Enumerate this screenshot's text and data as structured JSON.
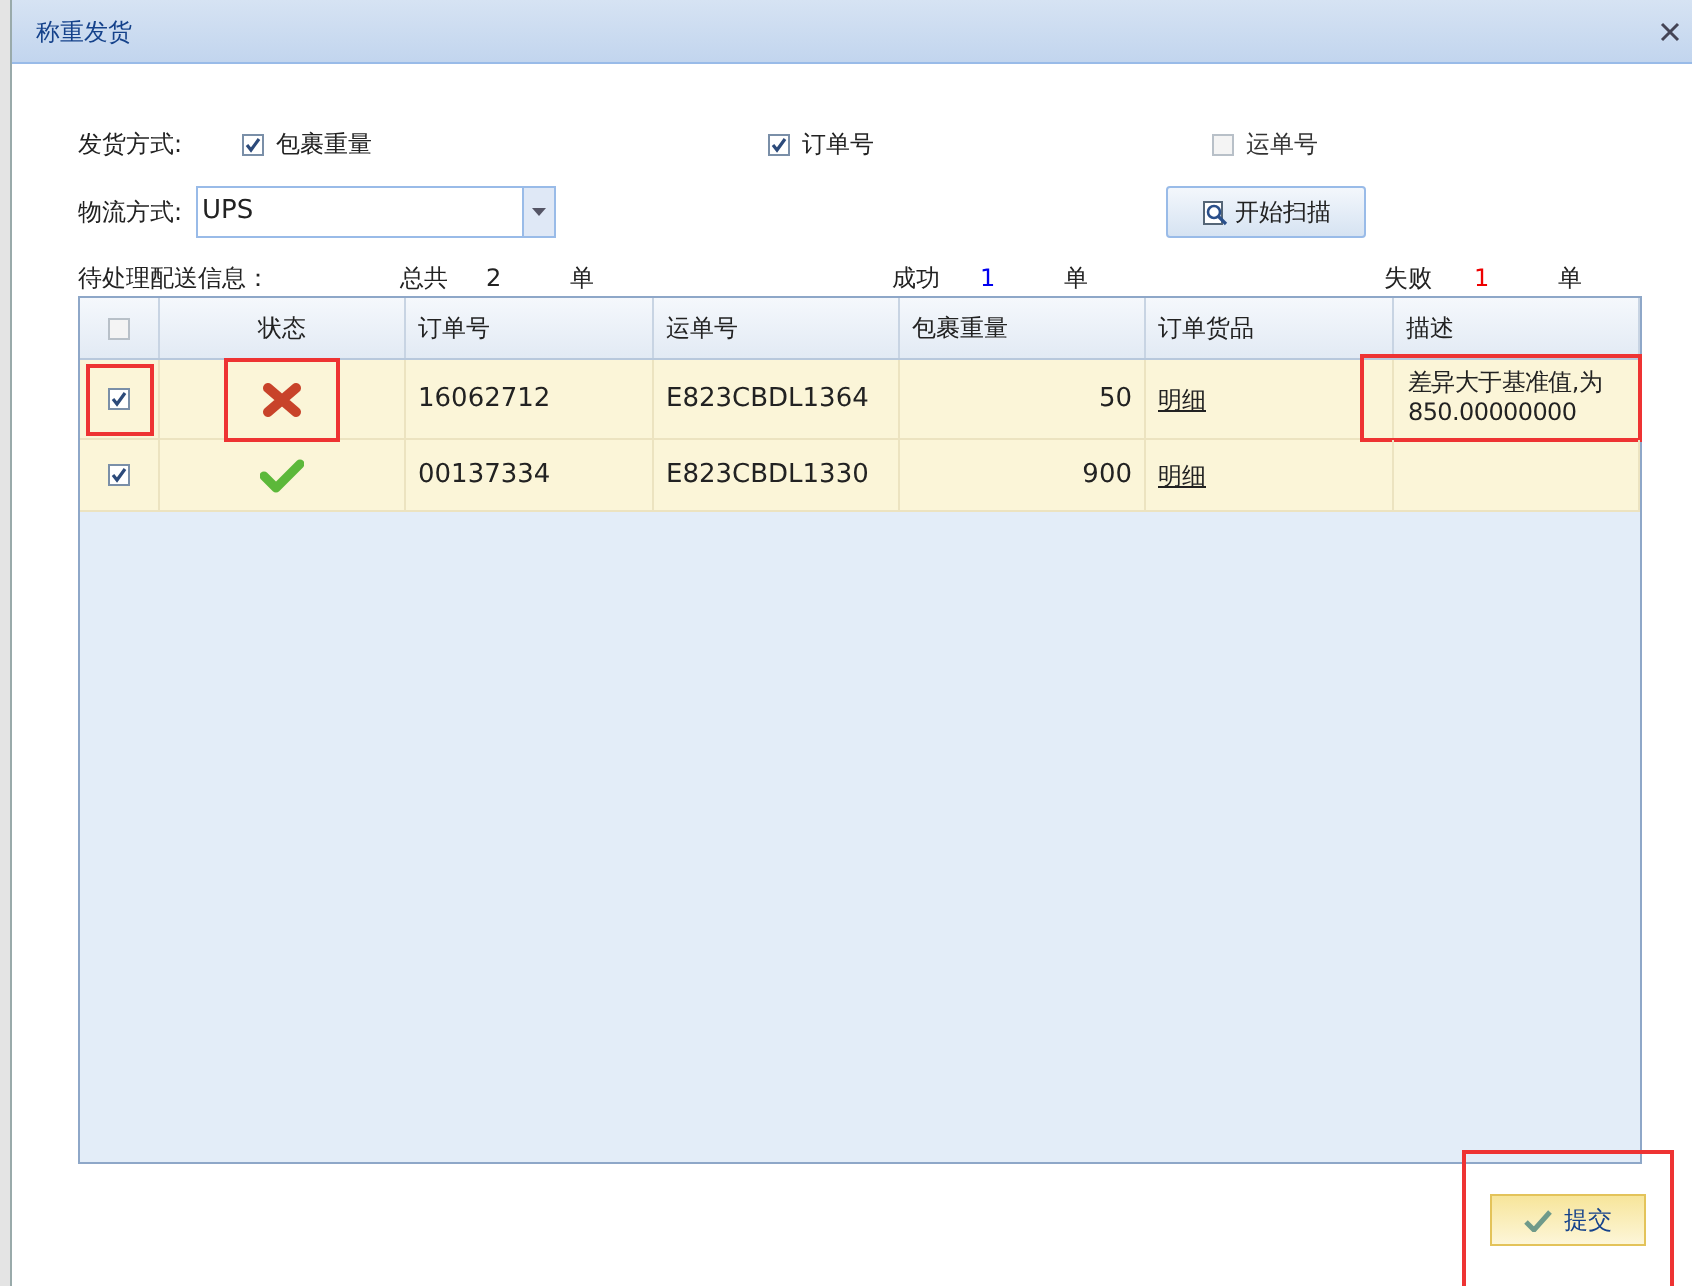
{
  "window": {
    "title": "称重发货"
  },
  "ship_mode": {
    "label": "发货方式:",
    "options": [
      {
        "label": "包裹重量",
        "checked": true
      },
      {
        "label": "订单号",
        "checked": true
      },
      {
        "label": "运单号",
        "checked": false
      }
    ]
  },
  "logistics": {
    "label": "物流方式:",
    "value": "UPS"
  },
  "scan_button": {
    "label": "开始扫描"
  },
  "summary": {
    "label": "待处理配送信息：",
    "total_label": "总共",
    "total": "2",
    "total_unit": "单",
    "success_label": "成功",
    "success": "1",
    "success_unit": "单",
    "fail_label": "失败",
    "fail": "1",
    "fail_unit": "单"
  },
  "table": {
    "select_all": false,
    "columns": [
      "状态",
      "订单号",
      "运单号",
      "包裹重量",
      "订单货品",
      "描述"
    ],
    "rows": [
      {
        "checked": true,
        "kind": "error",
        "order": "16062712",
        "waybill": "E823CBDL1364",
        "weight": "50",
        "goods": "明细",
        "description": "差异大于基准值,为850.00000000",
        "highlight_check": true,
        "highlight_status": true,
        "highlight_description": true
      },
      {
        "checked": true,
        "kind": "ok",
        "order": "00137334",
        "waybill": "E823CBDL1330",
        "weight": "900",
        "goods": "明细",
        "highlight_check": false,
        "highlight_status": false,
        "highlight_description": false
      }
    ]
  },
  "submit_button": {
    "label": "提交",
    "highlighted": true
  }
}
